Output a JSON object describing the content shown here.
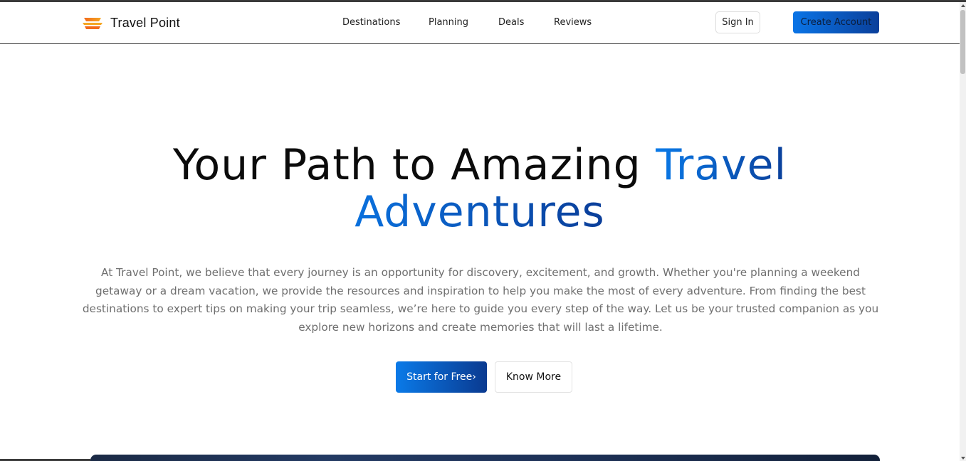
{
  "brand": {
    "name": "Travel Point",
    "logo_icon": "stacked-boat-logo-icon",
    "accent_start": "#0a7ae8",
    "accent_end": "#0a3f9a",
    "logo_orange": "#f26a1b",
    "logo_yellow": "#f5a623"
  },
  "nav": {
    "items": [
      {
        "label": "Destinations"
      },
      {
        "label": "Planning"
      },
      {
        "label": "Deals"
      },
      {
        "label": "Reviews"
      }
    ]
  },
  "header_actions": {
    "signin_label": "Sign In",
    "create_label": "Create Account"
  },
  "hero": {
    "title_part1": "Your Path to Amazing ",
    "title_accent": "Travel",
    "title_line2": "Adventures",
    "description": "At Travel Point, we believe that every journey is an opportunity for discovery, excitement, and growth. Whether you're planning a weekend getaway or a dream vacation, we provide the resources and inspiration to help you make the most of every adventure. From finding the best destinations to expert tips on making your trip seamless, we’re here to guide you every step of the way. Let us be your trusted companion as you explore new horizons and create memories that will last a lifetime.",
    "primary_button": "Start for Free›",
    "secondary_button": "Know More"
  }
}
